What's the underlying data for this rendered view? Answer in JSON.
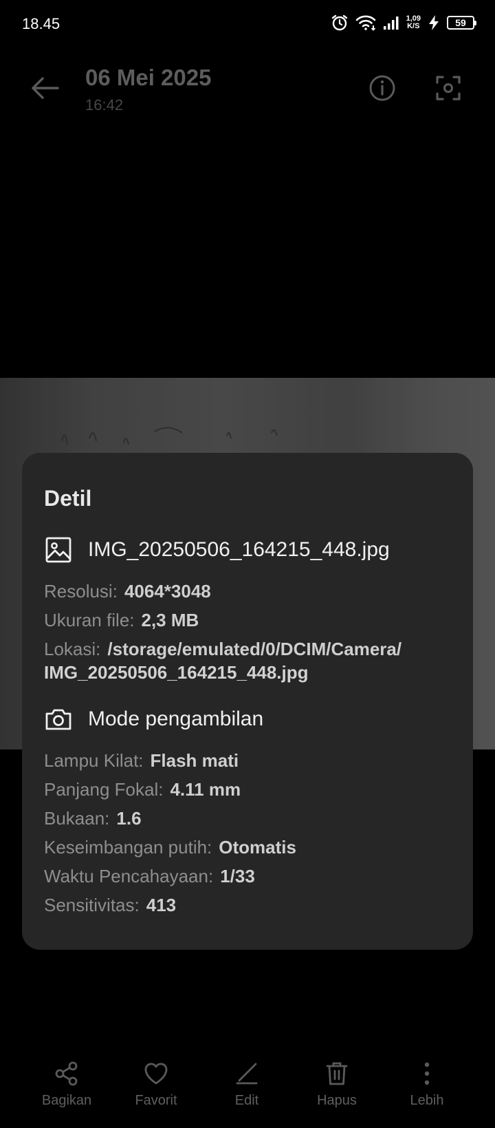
{
  "status_bar": {
    "time": "18.45",
    "speed_value": "1,09",
    "speed_unit": "K/S",
    "battery": "59",
    "icons": [
      "alarm-icon",
      "wifi-icon",
      "signal-icon",
      "charging-icon",
      "battery-icon"
    ]
  },
  "header": {
    "date": "06 Mei 2025",
    "time": "16:42",
    "icons": [
      "back-arrow-icon",
      "info-icon",
      "lens-icon"
    ]
  },
  "details": {
    "title": "Detil",
    "file": {
      "name": "IMG_20250506_164215_448.jpg",
      "resolution_label": "Resolusi:",
      "resolution": "4064*3048",
      "size_label": "Ukuran file:",
      "size": "2,3 MB",
      "location_label": "Lokasi:",
      "location_line1": "/storage/emulated/0/DCIM/Camera/",
      "location_line2": "IMG_20250506_164215_448.jpg"
    },
    "capture": {
      "title": "Mode pengambilan",
      "flash_label": "Lampu Kilat:",
      "flash": "Flash mati",
      "focal_label": "Panjang Fokal:",
      "focal": "4.11 mm",
      "aperture_label": "Bukaan:",
      "aperture": "1.6",
      "wb_label": "Keseimbangan putih:",
      "wb": "Otomatis",
      "exposure_label": "Waktu Pencahayaan:",
      "exposure": "1/33",
      "iso_label": "Sensitivitas:",
      "iso": "413"
    }
  },
  "bottom_bar": {
    "share": "Bagikan",
    "favorite": "Favorit",
    "edit": "Edit",
    "delete": "Hapus",
    "more": "Lebih"
  },
  "colors": {
    "card_bg": "#262626",
    "label": "#8e8e8e",
    "value": "#cfcfcf",
    "dim_text": "#5f5f5f"
  }
}
